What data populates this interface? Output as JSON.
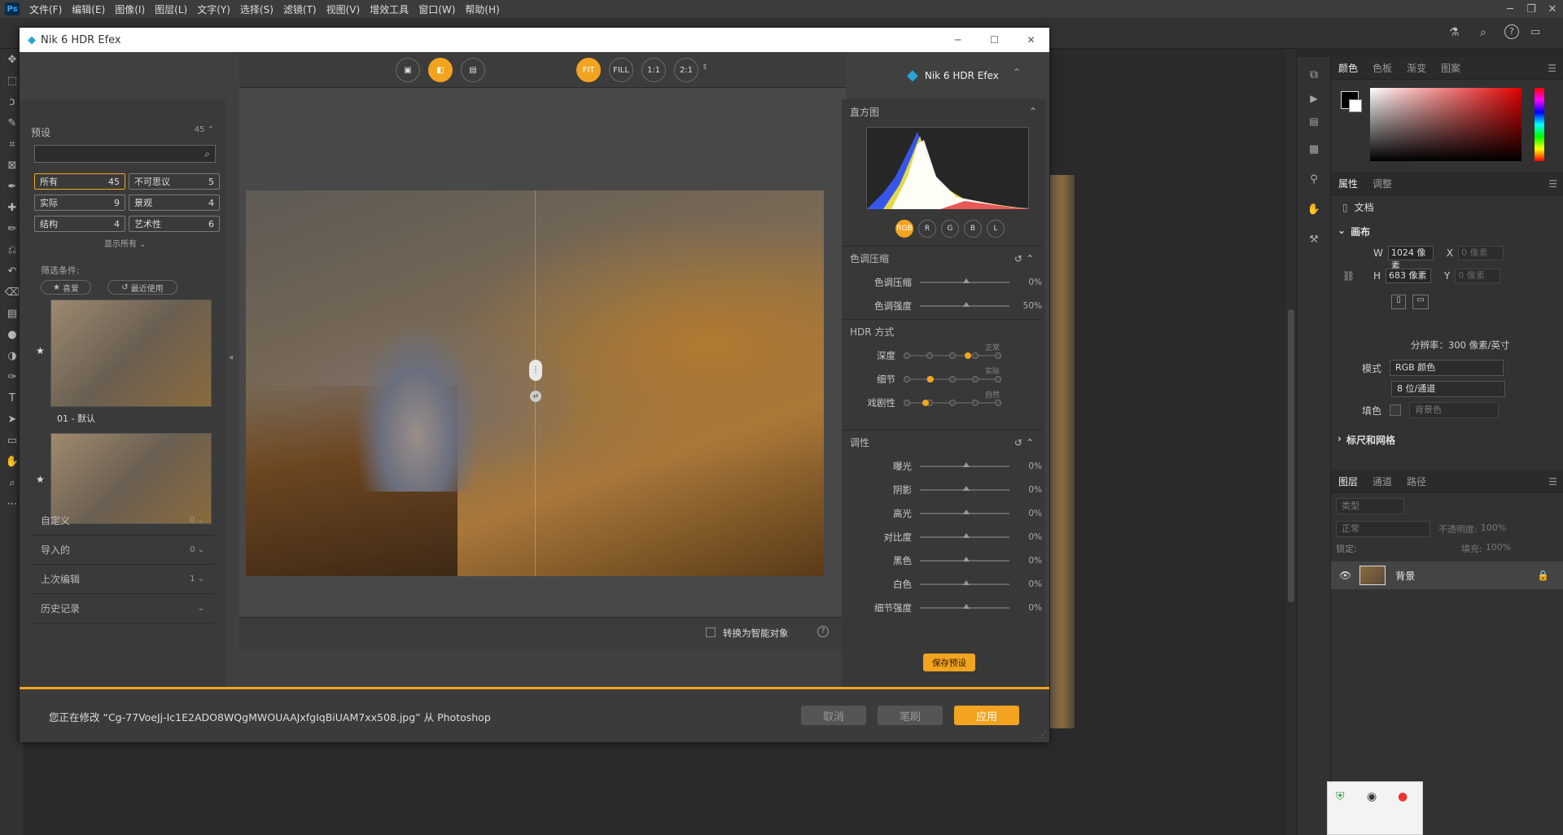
{
  "ps": {
    "logo": "Ps",
    "menus": [
      "文件(F)",
      "编辑(E)",
      "图像(I)",
      "图层(L)",
      "文字(Y)",
      "选择(S)",
      "滤镜(T)",
      "视图(V)",
      "增效工具",
      "窗口(W)",
      "帮助(H)"
    ],
    "tools": [
      "move-icon",
      "marquee-icon",
      "lasso-icon",
      "quick-select-icon",
      "crop-icon",
      "frame-icon",
      "eyedropper-icon",
      "healing-icon",
      "brush-icon",
      "stamp-icon",
      "history-brush-icon",
      "eraser-icon",
      "gradient-icon",
      "blur-icon",
      "dodge-icon",
      "pen-icon",
      "text-icon",
      "path-select-icon",
      "shape-icon",
      "hand-icon",
      "zoom-icon",
      "more-icon"
    ]
  },
  "panels": {
    "color_tabs": [
      "颜色",
      "色板",
      "渐变",
      "图案"
    ],
    "props_tabs": [
      "属性",
      "调整"
    ],
    "doc_label": "文档",
    "canvas_label": "画布",
    "w_label": "W",
    "w_value": "1024 像素",
    "h_label": "H",
    "h_value": "683 像素",
    "x_label": "X",
    "x_placeholder": "0 像素",
    "y_label": "Y",
    "y_placeholder": "0 像素",
    "resolution": "分辨率：300 像素/英寸",
    "mode_label": "模式",
    "mode_value": "RGB 颜色",
    "depth_value": "8 位/通道",
    "fill_label": "填色",
    "fill_value": "背景色",
    "rulers_label": "标尺和网格",
    "layers_tabs": [
      "图层",
      "通道",
      "路径"
    ],
    "layer_kind": "类型",
    "blend_mode": "正常",
    "opacity_label": "不透明度:",
    "opacity_value": "100%",
    "lock_label": "锁定:",
    "fill2_label": "填充:",
    "fill2_value": "100%",
    "layer_name": "背景"
  },
  "nik": {
    "title": "Nik 6 HDR Efex",
    "brand": "Nik 6 HDR Efex",
    "presets": {
      "header": "预设",
      "count": "45",
      "search_placeholder": "",
      "chips": [
        {
          "label": "所有",
          "count": "45"
        },
        {
          "label": "不可思议",
          "count": "5"
        },
        {
          "label": "实际",
          "count": "9"
        },
        {
          "label": "景观",
          "count": "4"
        },
        {
          "label": "结构",
          "count": "4"
        },
        {
          "label": "艺术性",
          "count": "6"
        }
      ],
      "show_all": "显示所有",
      "filter_label": "筛选条件:",
      "fav": "喜爱",
      "recent": "最近使用",
      "thumb1_label": "01 - 默认"
    },
    "sections": [
      {
        "label": "自定义",
        "count": "0"
      },
      {
        "label": "导入的",
        "count": "0"
      },
      {
        "label": "上次编辑",
        "count": "1"
      },
      {
        "label": "历史记录",
        "count": ""
      }
    ],
    "zoom": [
      "FIT",
      "FILL",
      "1:1",
      "2:1"
    ],
    "smart_object": "转换为智能对象",
    "histogram": {
      "title": "直方图",
      "channels": [
        "RGB",
        "R",
        "G",
        "B",
        "L"
      ]
    },
    "tone_compression": {
      "title": "色调压缩",
      "sliders": [
        {
          "label": "色调压缩",
          "value": "0%",
          "pos": 0.5
        },
        {
          "label": "色调强度",
          "value": "50%",
          "pos": 0.5
        }
      ]
    },
    "hdr_method": {
      "title": "HDR 方式",
      "rows": [
        {
          "label": "深度",
          "tag": "正常",
          "pos": 0.66
        },
        {
          "label": "细节",
          "tag": "实际",
          "pos": 0.25
        },
        {
          "label": "戏剧性",
          "tag": "自然",
          "pos": 0.2
        }
      ]
    },
    "tonality": {
      "title": "调性",
      "sliders": [
        {
          "label": "曝光",
          "value": "0%",
          "pos": 0.5
        },
        {
          "label": "阴影",
          "value": "0%",
          "pos": 0.5
        },
        {
          "label": "高光",
          "value": "0%",
          "pos": 0.5
        },
        {
          "label": "对比度",
          "value": "0%",
          "pos": 0.5
        },
        {
          "label": "黑色",
          "value": "0%",
          "pos": 0.5
        },
        {
          "label": "白色",
          "value": "0%",
          "pos": 0.5
        },
        {
          "label": "细节强度",
          "value": "0%",
          "pos": 0.5
        }
      ]
    },
    "save_preset": "保存预设",
    "footer_msg": "您正在修改 “Cg-77VoeJj-Ic1E2ADO8WQgMWOUAAJxfgIqBiUAM7xx508.jpg” 从 Photoshop",
    "cancel": "取消",
    "brush": "笔刷",
    "apply": "应用"
  },
  "colors": {
    "accent": "#f2a31f"
  }
}
